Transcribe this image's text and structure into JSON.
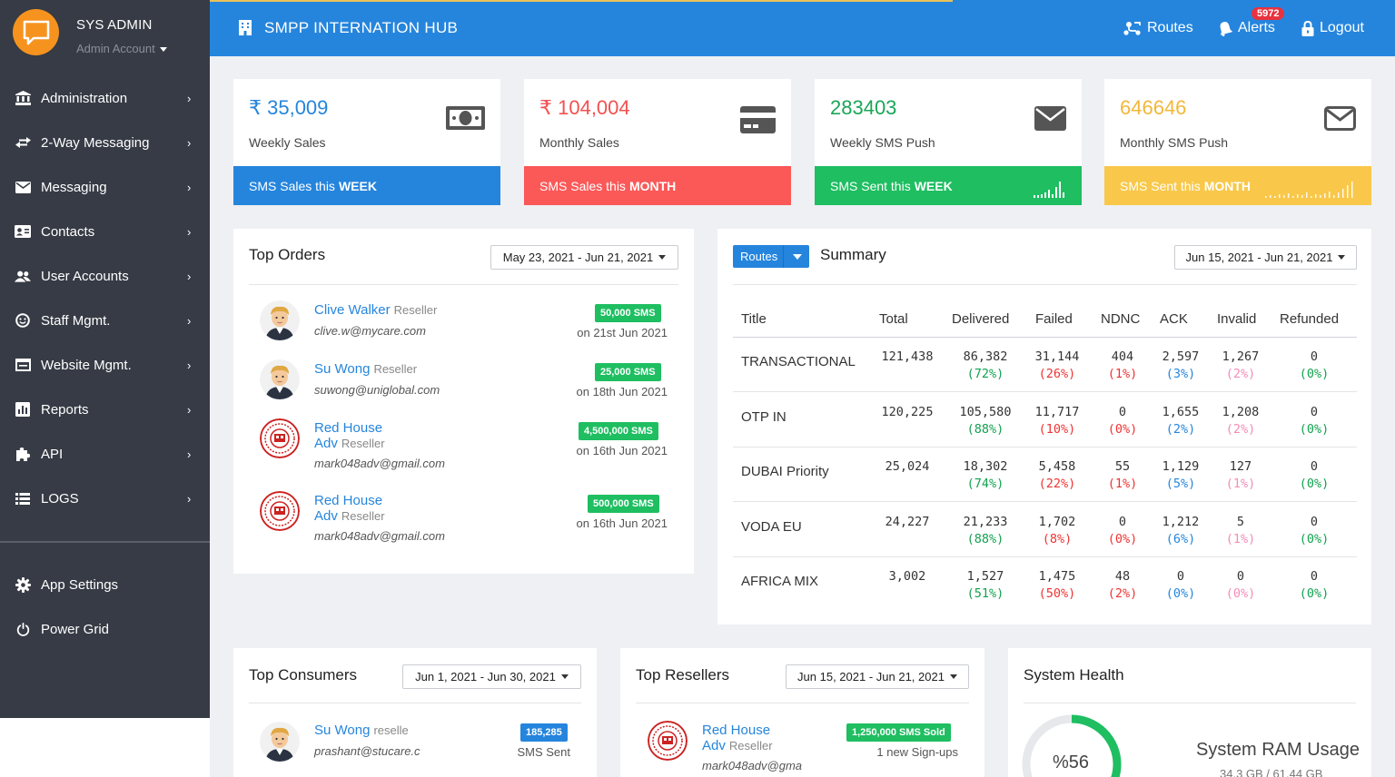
{
  "user": {
    "name": "SYS ADMIN",
    "role": "Admin Account"
  },
  "sidebar": {
    "items": [
      {
        "label": "Administration",
        "icon": "bank-icon"
      },
      {
        "label": "2-Way Messaging",
        "icon": "swap-arrows-icon"
      },
      {
        "label": "Messaging",
        "icon": "envelope-icon"
      },
      {
        "label": "Contacts",
        "icon": "contact-card-icon"
      },
      {
        "label": "User Accounts",
        "icon": "users-icon"
      },
      {
        "label": "Staff Mgmt.",
        "icon": "smile-icon"
      },
      {
        "label": "Website Mgmt.",
        "icon": "window-icon"
      },
      {
        "label": "Reports",
        "icon": "bar-chart-icon"
      },
      {
        "label": "API",
        "icon": "puzzle-icon"
      },
      {
        "label": "LOGS",
        "icon": "list-icon"
      }
    ],
    "bottom": [
      {
        "label": "App Settings",
        "icon": "gear-icon"
      },
      {
        "label": "Power Grid",
        "icon": "power-icon"
      }
    ]
  },
  "header": {
    "title": "SMPP INTERNATION HUB",
    "routes": "Routes",
    "alerts": "Alerts",
    "alerts_count": "5972",
    "logout": "Logout"
  },
  "stats": [
    {
      "value": "₹ 35,009",
      "label": "Weekly Sales",
      "footer": "SMS Sales this",
      "footer_bold": "WEEK",
      "color": "#2585dd",
      "value_color": "#2585dd"
    },
    {
      "value": "₹ 104,004",
      "label": "Monthly Sales",
      "footer": "SMS Sales this",
      "footer_bold": "MONTH",
      "color": "#fb5858",
      "value_color": "#f25050"
    },
    {
      "value": "283403",
      "label": "Weekly SMS Push",
      "footer": "SMS Sent this",
      "footer_bold": "WEEK",
      "color": "#1ebe61",
      "value_color": "#1aa657"
    },
    {
      "value": "646646",
      "label": "Monthly SMS Push",
      "footer": "SMS Sent this",
      "footer_bold": "MONTH",
      "color": "#f9c84a",
      "value_color": "#f3b73a"
    }
  ],
  "top_orders": {
    "title": "Top Orders",
    "date_range": "May 23, 2021 - Jun 21, 2021",
    "orders": [
      {
        "name": "Clive Walker",
        "tag": "Reseller",
        "email": "clive.w@mycare.com",
        "badge": "50,000 SMS",
        "date": "on 21st Jun 2021"
      },
      {
        "name": "Su Wong",
        "tag": "Reseller",
        "email": "suwong@uniglobal.com",
        "badge": "25,000 SMS",
        "date": "on 18th Jun 2021"
      },
      {
        "name": "Red House Adv",
        "tag": "Reseller",
        "email": "mark048adv@gmail.com",
        "badge": "4,500,000 SMS",
        "date": "on 16th Jun 2021"
      },
      {
        "name": "Red House Adv",
        "tag": "Reseller",
        "email": "mark048adv@gmail.com",
        "badge": "500,000 SMS",
        "date": "on 16th Jun 2021"
      }
    ]
  },
  "summary": {
    "button": "Routes",
    "title": "Summary",
    "date_range": "Jun 15, 2021 - Jun 21, 2021",
    "columns": [
      "Title",
      "Total",
      "Delivered",
      "Failed",
      "NDNC",
      "ACK",
      "Invalid",
      "Refunded"
    ],
    "rows": [
      {
        "title": "TRANSACTIONAL",
        "total": "121,438",
        "delivered": "86,382",
        "delivered_pct": "(72%)",
        "failed": "31,144",
        "failed_pct": "(26%)",
        "ndnc": "404",
        "ndnc_pct": "(1%)",
        "ack": "2,597",
        "ack_pct": "(3%)",
        "invalid": "1,267",
        "invalid_pct": "(2%)",
        "refunded": "0",
        "refunded_pct": "(0%)"
      },
      {
        "title": "OTP IN",
        "total": "120,225",
        "delivered": "105,580",
        "delivered_pct": "(88%)",
        "failed": "11,717",
        "failed_pct": "(10%)",
        "ndnc": "0",
        "ndnc_pct": "(0%)",
        "ack": "1,655",
        "ack_pct": "(2%)",
        "invalid": "1,208",
        "invalid_pct": "(2%)",
        "refunded": "0",
        "refunded_pct": "(0%)"
      },
      {
        "title": "DUBAI Priority",
        "total": "25,024",
        "delivered": "18,302",
        "delivered_pct": "(74%)",
        "failed": "5,458",
        "failed_pct": "(22%)",
        "ndnc": "55",
        "ndnc_pct": "(1%)",
        "ack": "1,129",
        "ack_pct": "(5%)",
        "invalid": "127",
        "invalid_pct": "(1%)",
        "refunded": "0",
        "refunded_pct": "(0%)"
      },
      {
        "title": "VODA EU",
        "total": "24,227",
        "delivered": "21,233",
        "delivered_pct": "(88%)",
        "failed": "1,702",
        "failed_pct": "(8%)",
        "ndnc": "0",
        "ndnc_pct": "(0%)",
        "ack": "1,212",
        "ack_pct": "(6%)",
        "invalid": "5",
        "invalid_pct": "(1%)",
        "refunded": "0",
        "refunded_pct": "(0%)"
      },
      {
        "title": "AFRICA MIX",
        "total": "3,002",
        "delivered": "1,527",
        "delivered_pct": "(51%)",
        "failed": "1,475",
        "failed_pct": "(50%)",
        "ndnc": "48",
        "ndnc_pct": "(2%)",
        "ack": "0",
        "ack_pct": "(0%)",
        "invalid": "0",
        "invalid_pct": "(0%)",
        "refunded": "0",
        "refunded_pct": "(0%)"
      }
    ]
  },
  "top_consumers": {
    "title": "Top Consumers",
    "date_range": "Jun 1, 2021 - Jun 30, 2021",
    "items": [
      {
        "name": "Su Wong",
        "tag": "reselle",
        "email": "prashant@stucare.c",
        "badge": "185,285",
        "sub": "SMS Sent"
      }
    ]
  },
  "top_resellers": {
    "title": "Top Resellers",
    "date_range": "Jun 15, 2021 - Jun 21, 2021",
    "items": [
      {
        "name": "Red House Adv",
        "tag": "Reseller",
        "email": "mark048adv@gma",
        "badge": "1,250,000 SMS Sold",
        "sub": "1 new Sign-ups"
      }
    ]
  },
  "system_health": {
    "title": "System Health",
    "gauge_label": "%56",
    "gauge_value": 56,
    "ram_title": "System RAM Usage",
    "ram_sub": "34.3 GB / 61.44 GB"
  }
}
